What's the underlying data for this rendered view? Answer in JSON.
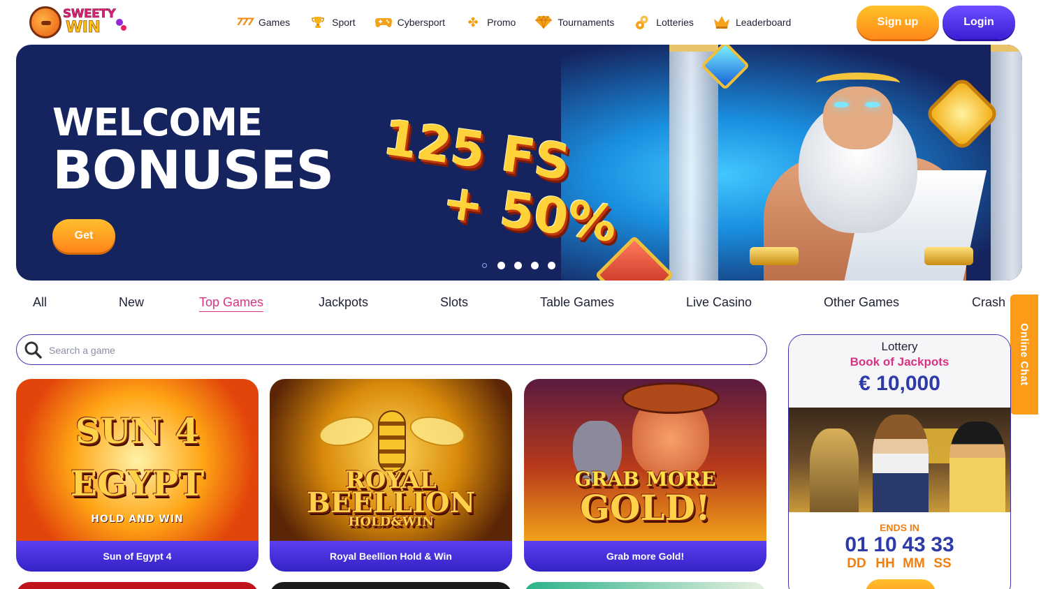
{
  "header": {
    "logo": {
      "line1": "SWEETY",
      "line2": "WIN"
    },
    "nav": [
      {
        "label": "Games",
        "icon": "slot-sevens-icon",
        "glyph": "777"
      },
      {
        "label": "Sport",
        "icon": "trophy-icon",
        "glyph": "🏆"
      },
      {
        "label": "Cybersport",
        "icon": "gamepad-icon",
        "glyph": "🎮"
      },
      {
        "label": "Promo",
        "icon": "clover-icon",
        "glyph": "✤"
      },
      {
        "label": "Tournaments",
        "icon": "diamond-icon",
        "glyph": "◆"
      },
      {
        "label": "Lotteries",
        "icon": "lottery-balls-icon",
        "glyph": "●"
      },
      {
        "label": "Leaderboard",
        "icon": "crown-icon",
        "glyph": "♛"
      }
    ],
    "signup_label": "Sign up",
    "login_label": "Login"
  },
  "banner": {
    "title_line1": "WELCOME",
    "title_line2": "BONUSES",
    "promo_line1": "125 FS",
    "promo_line2": "+ 50%",
    "cta_label": "Get",
    "slides_total": 5,
    "active_slide": 1
  },
  "tabs": [
    {
      "label": "All",
      "active": false
    },
    {
      "label": "New",
      "active": false
    },
    {
      "label": "Top Games",
      "active": true
    },
    {
      "label": "Jackpots",
      "active": false
    },
    {
      "label": "Slots",
      "active": false
    },
    {
      "label": "Table Games",
      "active": false
    },
    {
      "label": "Live Casino",
      "active": false
    },
    {
      "label": "Other Games",
      "active": false
    },
    {
      "label": "Crash",
      "active": false
    }
  ],
  "search": {
    "placeholder": "Search a game",
    "value": ""
  },
  "chat": {
    "label": "Online Chat"
  },
  "games": [
    {
      "name": "Sun of Egypt 4",
      "art": {
        "line1": "SUN 4",
        "line2": "EGYPT",
        "line3": "HOLD AND WIN"
      }
    },
    {
      "name": "Royal Beellion Hold & Win",
      "art": {
        "line1": "ROYAL",
        "line2": "BEELLION",
        "line3": "HOLD&WIN"
      }
    },
    {
      "name": "Grab more Gold!",
      "art": {
        "line1": "GRAB MORE",
        "line2": "GOLD!"
      }
    }
  ],
  "lottery": {
    "type": "Lottery",
    "name": "Book of Jackpots",
    "amount": "€ 10,000",
    "ends_label": "ENDS IN",
    "timer": [
      {
        "value": "01",
        "unit": "DD"
      },
      {
        "value": "10",
        "unit": "HH"
      },
      {
        "value": "43",
        "unit": "MM"
      },
      {
        "value": "33",
        "unit": "SS"
      }
    ]
  },
  "colors": {
    "brand_orange": "#ff8a1a",
    "brand_purple": "#3b1fd4",
    "accent_pink": "#d63384",
    "banner_navy": "#15245f",
    "timer_blue": "#2d3aa8"
  }
}
